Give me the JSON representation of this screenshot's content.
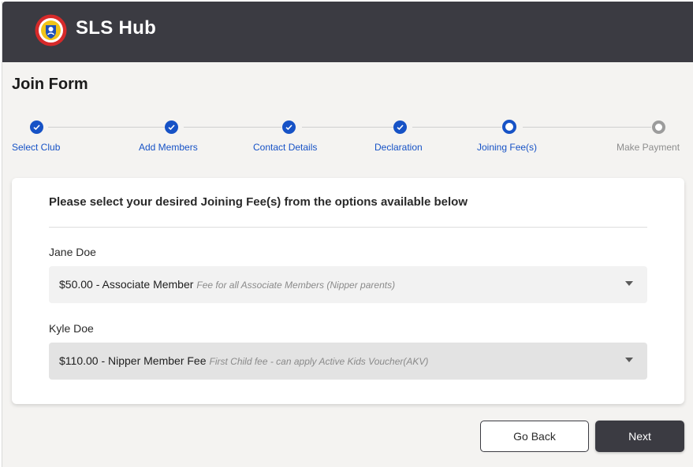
{
  "app": {
    "title": "SLS Hub",
    "logo_icon": "surf-life-saving-logo"
  },
  "page": {
    "title": "Join Form"
  },
  "stepper": {
    "steps": [
      {
        "label": "Select Club",
        "state": "done"
      },
      {
        "label": "Add Members",
        "state": "done"
      },
      {
        "label": "Contact Details",
        "state": "done"
      },
      {
        "label": "Declaration",
        "state": "done"
      },
      {
        "label": "Joining Fee(s)",
        "state": "current"
      },
      {
        "label": "Make Payment",
        "state": "pending"
      }
    ]
  },
  "card": {
    "instruction": "Please select your desired Joining Fee(s) from the options available below",
    "members": [
      {
        "name": "Jane Doe",
        "selected_fee": "$50.00 - Associate Member",
        "fee_description": "Fee for all Associate Members (Nipper parents)"
      },
      {
        "name": "Kyle Doe",
        "selected_fee": "$110.00 - Nipper Member Fee",
        "fee_description": "First Child fee - can apply Active Kids Voucher(AKV)"
      }
    ]
  },
  "actions": {
    "back_label": "Go Back",
    "next_label": "Next"
  },
  "colors": {
    "header": "#3b3b42",
    "accent": "#1652c6",
    "pending": "#9c9c9c"
  }
}
